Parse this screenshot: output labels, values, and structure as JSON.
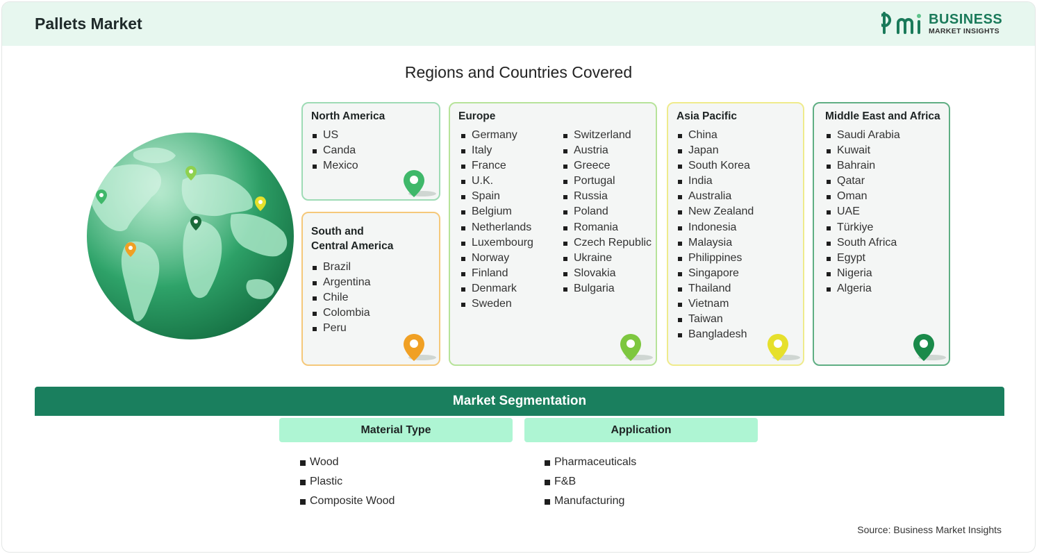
{
  "header": {
    "title": "Pallets Market",
    "logo_line1": "BUSINESS",
    "logo_line2": "MARKET INSIGHTS"
  },
  "regions_title": "Regions and Countries Covered",
  "regions": {
    "north_america": {
      "name": "North America",
      "countries": [
        "US",
        "Canda",
        "Mexico"
      ],
      "pin_color": "#3fb86a"
    },
    "south_central_america": {
      "name_line1": "South and",
      "name_line2": "Central America",
      "countries": [
        "Brazil",
        "Argentina",
        "Chile",
        "Colombia",
        "Peru"
      ],
      "pin_color": "#f0a024"
    },
    "europe": {
      "name": "Europe",
      "col1": [
        "Germany",
        "Italy",
        "France",
        "U.K.",
        "Spain",
        "Belgium",
        "Netherlands",
        "Luxembourg",
        "Norway",
        "Finland",
        "Denmark",
        "Sweden"
      ],
      "col2": [
        "Switzerland",
        "Austria",
        "Greece",
        "Portugal",
        "Russia",
        "Poland",
        "Romania",
        "Czech Republic",
        "Ukraine",
        "Slovakia",
        "Bulgaria"
      ],
      "pin_color": "#7dc73f"
    },
    "asia_pacific": {
      "name": "Asia Pacific",
      "countries": [
        "China",
        "Japan",
        "South Korea",
        "India",
        "Australia",
        "New Zealand",
        "Indonesia",
        "Malaysia",
        "Philippines",
        "Singapore",
        "Thailand",
        "Vietnam",
        "Taiwan",
        "Bangladesh"
      ],
      "pin_color": "#e6e02c"
    },
    "mea": {
      "name": "Middle East and Africa",
      "countries": [
        "Saudi Arabia",
        "Kuwait",
        "Bahrain",
        "Qatar",
        "Oman",
        "UAE",
        "Türkiye",
        "South Africa",
        "Egypt",
        "Nigeria",
        "Algeria"
      ],
      "pin_color": "#1a8a4a"
    }
  },
  "segmentation": {
    "title": "Market Segmentation",
    "groups": [
      {
        "heading": "Material Type",
        "items": [
          "Wood",
          "Plastic",
          "Composite Wood"
        ]
      },
      {
        "heading": "Application",
        "items": [
          "Pharmaceuticals",
          "F&B",
          "Manufacturing"
        ]
      }
    ]
  },
  "source": "Source: Business Market Insights",
  "colors": {
    "brand_green": "#1a7f5e",
    "header_bg": "#e7f7ef",
    "segment_head_bg": "#aef5d3"
  }
}
